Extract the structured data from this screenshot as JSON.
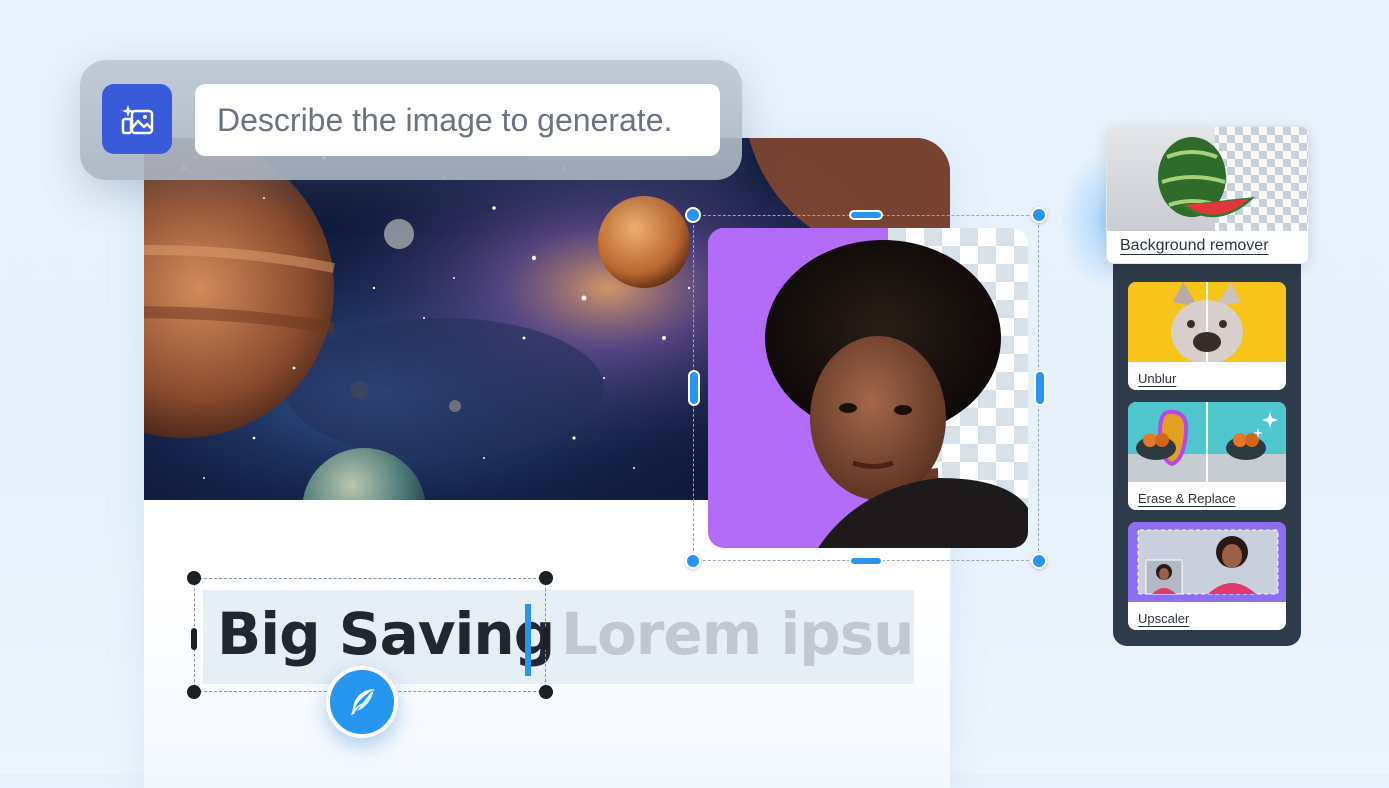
{
  "prompt": {
    "placeholder": "Describe the image to generate."
  },
  "canvas": {
    "headline": "Big Saving",
    "ghost_text": "Lorem ipsur"
  },
  "tools": {
    "background_remover": "Background remover",
    "items": [
      {
        "label": "Unblur"
      },
      {
        "label": "Erase & Replace"
      },
      {
        "label": "Upscaler"
      }
    ]
  },
  "colors": {
    "accent": "#2a94f4",
    "generate_button": "#3a5bd9",
    "panel_dark": "#2e3b4b",
    "portrait_bg": "#b36cf7"
  }
}
